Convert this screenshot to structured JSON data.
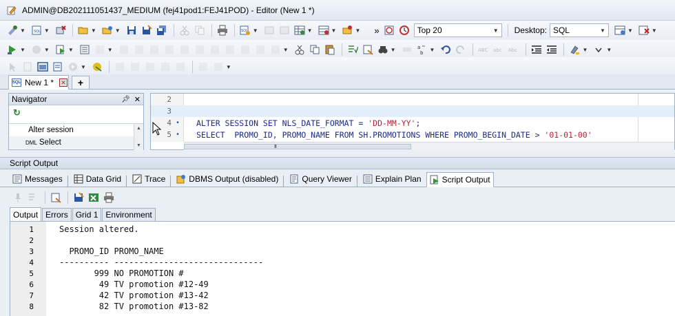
{
  "window": {
    "title": "ADMIN@DB202111051437_MEDIUM (fej41pod1:FEJ41POD) - Editor (New 1 *)"
  },
  "toolbar": {
    "top_rows_combo": "Top 20",
    "desktop_label": "Desktop:",
    "desktop_combo": "SQL",
    "overflow": "»"
  },
  "editor_tabs": [
    {
      "label": "New 1 *",
      "icon": "sql-file-icon"
    }
  ],
  "navigator": {
    "title": "Navigator",
    "items": [
      {
        "label": "Alter session",
        "prefix": ""
      },
      {
        "label": "Select",
        "prefix": "DML"
      }
    ]
  },
  "editor": {
    "lines": [
      {
        "num": "2",
        "marker": "",
        "code": "",
        "string": "",
        "code_end": ""
      },
      {
        "num": "3",
        "marker": "",
        "code": "",
        "string": "",
        "code_end": ""
      },
      {
        "num": "4",
        "marker": "•",
        "code": "ALTER SESSION SET NLS_DATE_FORMAT = ",
        "string": "'DD-MM-YY'",
        "code_end": ";"
      },
      {
        "num": "5",
        "marker": "•",
        "code": "SELECT  PROMO_ID, PROMO_NAME FROM SH.PROMOTIONS WHERE PROMO_BEGIN_DATE > ",
        "string": "'01-01-00'",
        "code_end": ""
      }
    ],
    "scroll_grip": "III"
  },
  "script_output": {
    "title": "Script Output",
    "subtabs": [
      {
        "label": "Messages",
        "icon": "messages-icon"
      },
      {
        "label": "Data Grid",
        "icon": "data-grid-icon"
      },
      {
        "label": "Trace",
        "icon": "trace-icon"
      },
      {
        "label": "DBMS Output (disabled)",
        "icon": "dbms-output-icon"
      },
      {
        "label": "Query Viewer",
        "icon": "query-viewer-icon"
      },
      {
        "label": "Explain Plan",
        "icon": "explain-plan-icon"
      },
      {
        "label": "Script Output",
        "icon": "script-output-icon"
      }
    ],
    "output_tabs": [
      "Output",
      "Errors",
      "Grid 1",
      "Environment"
    ],
    "lines": [
      {
        "num": "1",
        "text": "Session altered."
      },
      {
        "num": "2",
        "text": ""
      },
      {
        "num": "3",
        "text": "  PROMO_ID PROMO_NAME"
      },
      {
        "num": "4",
        "text": "---------- ------------------------------"
      },
      {
        "num": "5",
        "text": "       999 NO PROMOTION #"
      },
      {
        "num": "6",
        "text": "        49 TV promotion #12-49"
      },
      {
        "num": "7",
        "text": "        42 TV promotion #13-42"
      },
      {
        "num": "8",
        "text": "        82 TV promotion #13-82"
      }
    ]
  },
  "colors": {
    "keyword": "#1c2a8a",
    "string": "#b8203c",
    "highlight": "#e3eefb",
    "panel": "#eaeef5"
  }
}
